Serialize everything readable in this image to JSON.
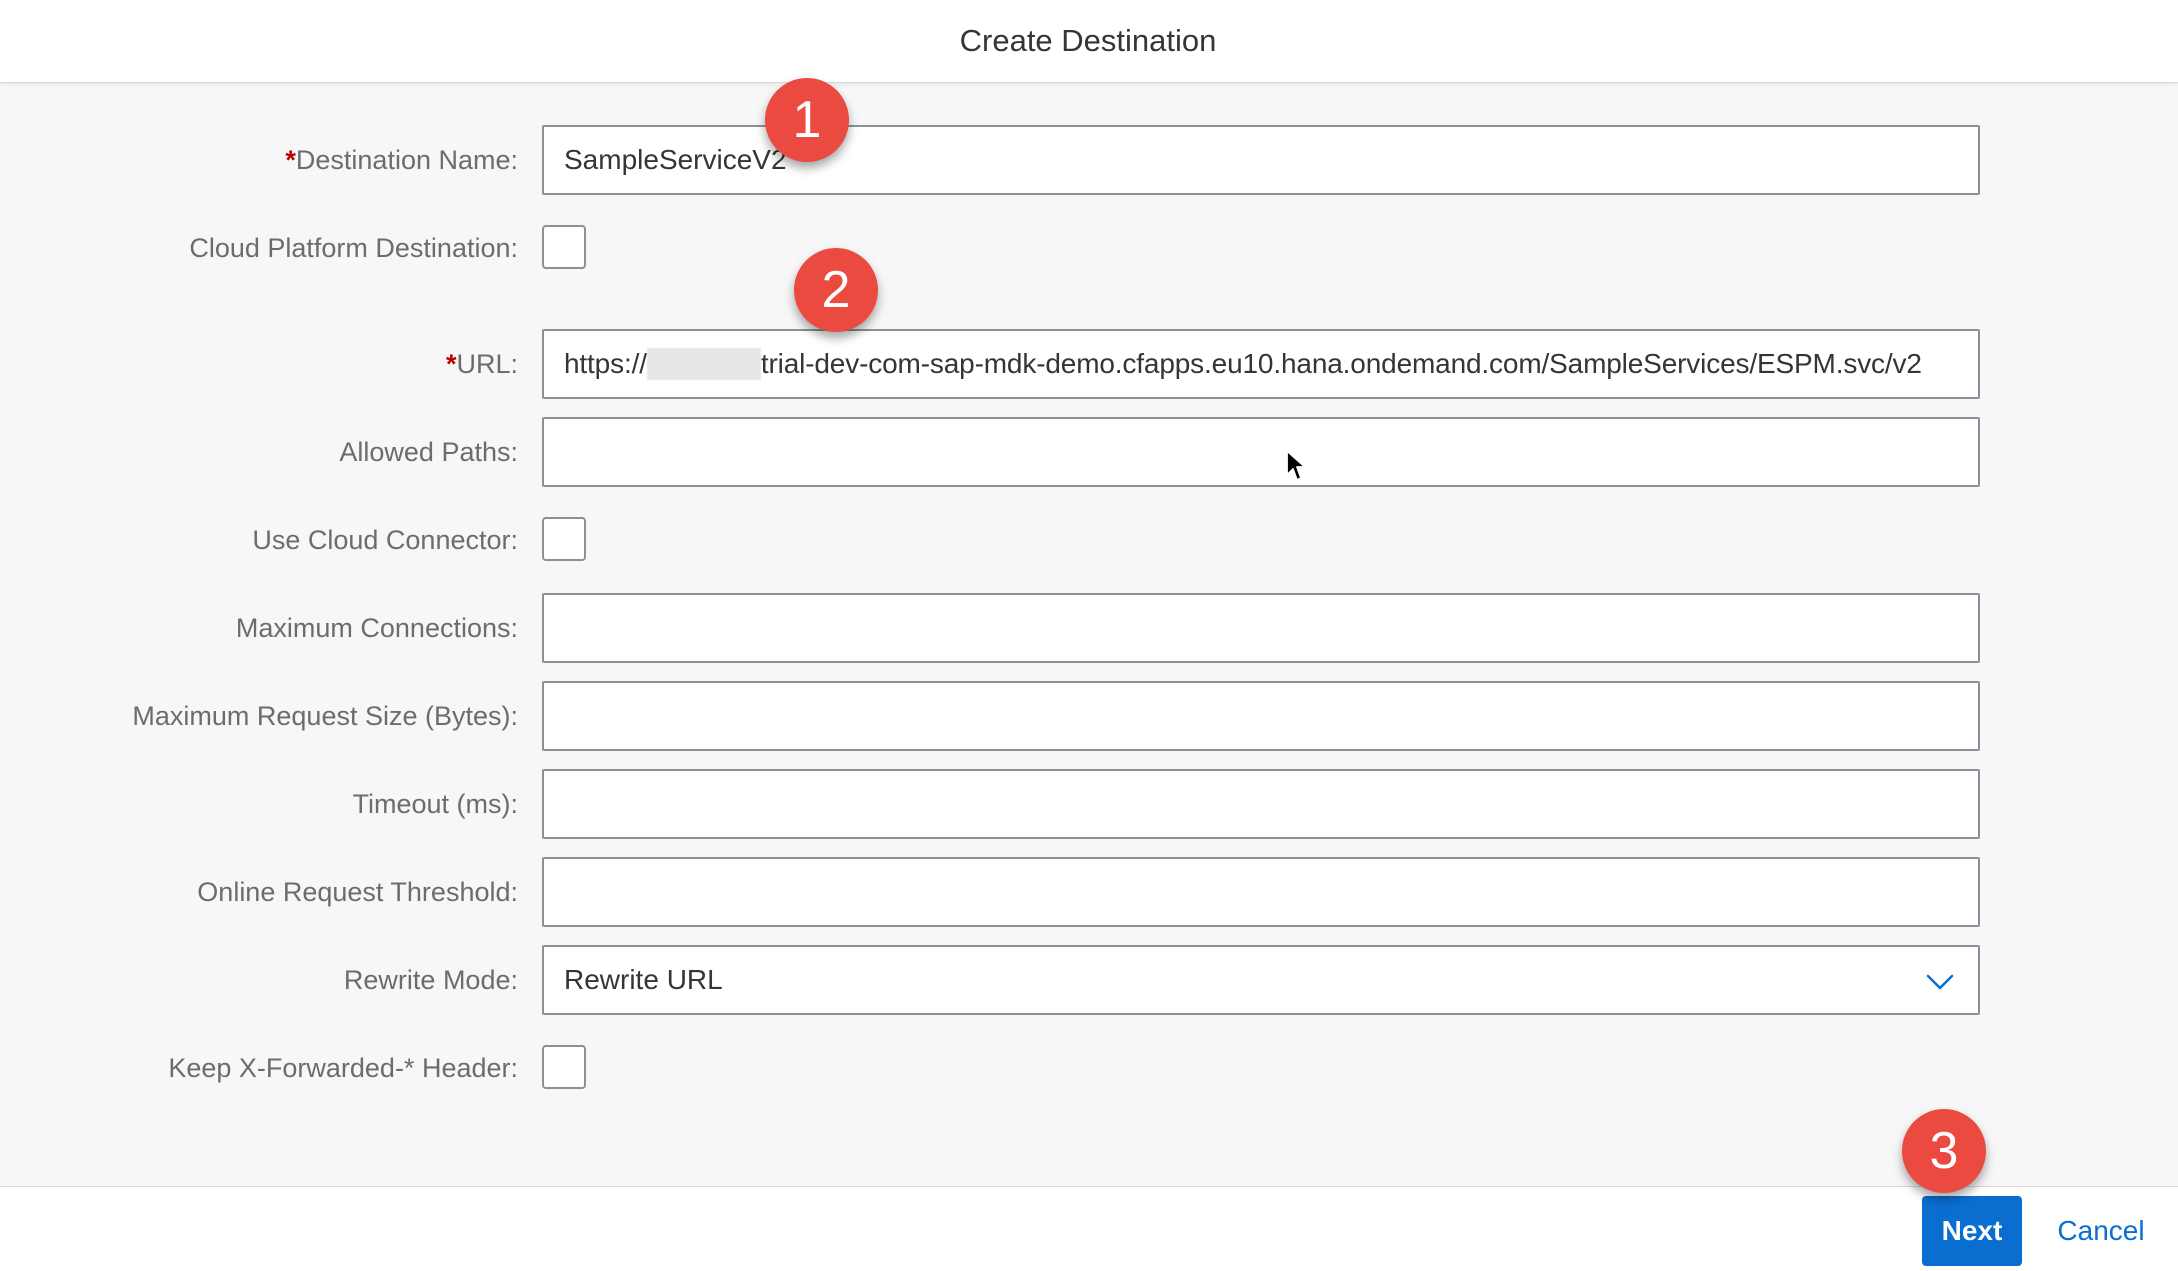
{
  "dialog": {
    "title": "Create Destination"
  },
  "form": {
    "destination_name": {
      "required_mark": "*",
      "label": "Destination Name:",
      "value": "SampleServiceV2"
    },
    "cloud_platform_destination": {
      "label": "Cloud Platform Destination:",
      "checked": false
    },
    "url": {
      "required_mark": "*",
      "label": "URL:",
      "value_prefix": "https://",
      "value_suffix": "trial-dev-com-sap-mdk-demo.cfapps.eu10.hana.ondemand.com/SampleServices/ESPM.svc/v2"
    },
    "allowed_paths": {
      "label": "Allowed Paths:",
      "value": ""
    },
    "use_cloud_connector": {
      "label": "Use Cloud Connector:",
      "checked": false
    },
    "maximum_connections": {
      "label": "Maximum Connections:",
      "value": ""
    },
    "maximum_request_size": {
      "label": "Maximum Request Size (Bytes):",
      "value": ""
    },
    "timeout": {
      "label": "Timeout (ms):",
      "value": ""
    },
    "online_request_threshold": {
      "label": "Online Request Threshold:",
      "value": ""
    },
    "rewrite_mode": {
      "label": "Rewrite Mode:",
      "value": "Rewrite URL",
      "icon": "chevron-down-icon"
    },
    "keep_x_forwarded_header": {
      "label": "Keep X-Forwarded-* Header:",
      "checked": false
    }
  },
  "markers": {
    "step1": "1",
    "step2": "2",
    "step3": "3"
  },
  "footer": {
    "next_label": "Next",
    "cancel_label": "Cancel"
  },
  "colors": {
    "accent": "#0a6ed1",
    "required": "#bb0000",
    "marker": "#ea4a3f",
    "label": "#6a6d70",
    "text": "#32363a",
    "input_border": "#89919a",
    "background": "#f7f7f7"
  }
}
